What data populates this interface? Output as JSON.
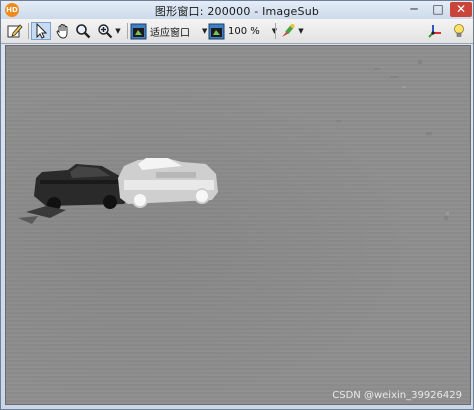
{
  "window": {
    "app_icon_text": "HD",
    "title": "图形窗口: 200000 - ImageSub",
    "minimize_symbol": "─",
    "maximize_symbol": "□",
    "close_symbol": "✕"
  },
  "toolbar": {
    "fit_label": "适应窗口",
    "zoom_value": "100 %",
    "caret": "▼"
  },
  "image": {
    "watermark": "CSDN @weixin_39926429"
  },
  "icons": [
    "edit-icon",
    "pointer-icon",
    "hand-icon",
    "magnifier-icon",
    "zoom-in-icon",
    "fit-window-icon",
    "zoom-icon",
    "paint-icon",
    "axes-icon",
    "lightbulb-icon"
  ]
}
